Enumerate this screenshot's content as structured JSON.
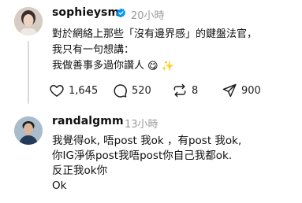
{
  "post": {
    "username": "sophieysm",
    "time": "20小時",
    "lines": [
      "對於網絡上那些「沒有邊界感」的鍵盤法官，",
      "我只有一句想講：",
      "我做善事多過你讚人"
    ],
    "emoji_1": "😋",
    "emoji_2": "✨",
    "likes": "1,645",
    "replies": "520",
    "reposts": "8",
    "shares": "900"
  },
  "reply": {
    "username": "randalgmm",
    "time": "13小時",
    "lines": [
      "我覺得ok, 唔post 我ok ，有post 我ok,",
      "你IG淨係post我唔post你自己我都ok.",
      "反正我ok你",
      "Ok"
    ]
  },
  "colors": {
    "verified": "#0095f6",
    "muted": "#999999"
  }
}
